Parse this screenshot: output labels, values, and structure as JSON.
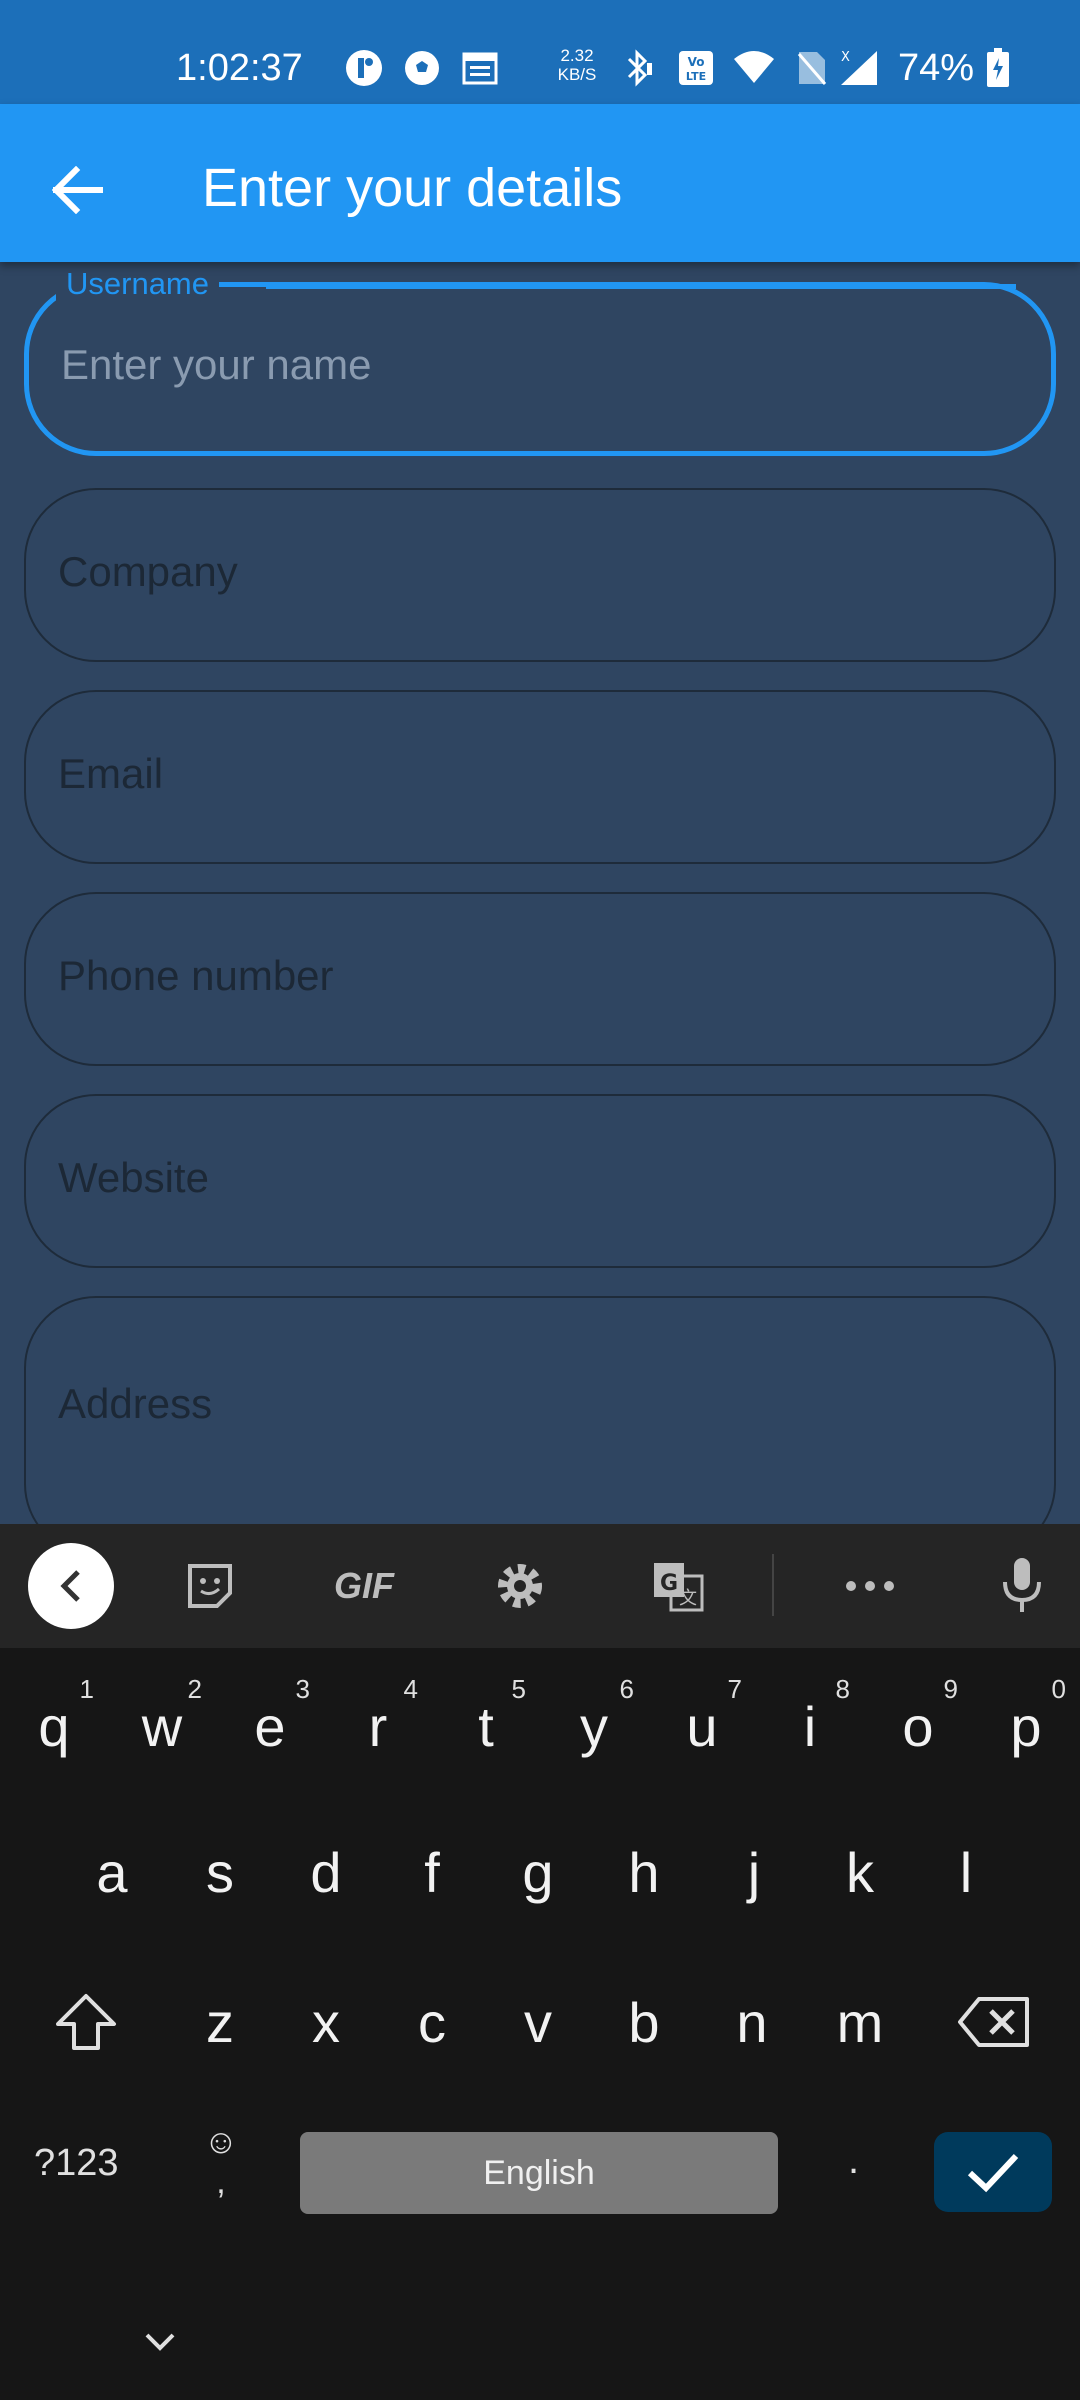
{
  "status_bar": {
    "time": "1:02:37",
    "net_speed_value": "2.32",
    "net_speed_unit": "KB/S",
    "battery": "74%",
    "icons": [
      "notification-icon",
      "soccer-ball-icon",
      "calendar-icon",
      "bluetooth-icon",
      "volte-icon",
      "wifi-icon",
      "no-sim-icon",
      "signal-icon",
      "battery-charging-icon"
    ]
  },
  "app_bar": {
    "title": "Enter your details",
    "back_icon": "arrow-back-icon"
  },
  "form": {
    "fields": [
      {
        "label": "Username",
        "placeholder": "Enter your name",
        "focused": true
      },
      {
        "placeholder": "Company"
      },
      {
        "placeholder": "Email"
      },
      {
        "placeholder": "Phone number"
      },
      {
        "placeholder": "Website"
      },
      {
        "placeholder": "Address"
      }
    ]
  },
  "keyboard": {
    "toolbar": [
      "collapse-icon",
      "sticker-icon",
      "GIF",
      "settings-icon",
      "translate-icon",
      "more-icon",
      "microphone-icon"
    ],
    "gif_label": "GIF",
    "row1": [
      {
        "key": "q",
        "hint": "1"
      },
      {
        "key": "w",
        "hint": "2"
      },
      {
        "key": "e",
        "hint": "3"
      },
      {
        "key": "r",
        "hint": "4"
      },
      {
        "key": "t",
        "hint": "5"
      },
      {
        "key": "y",
        "hint": "6"
      },
      {
        "key": "u",
        "hint": "7"
      },
      {
        "key": "i",
        "hint": "8"
      },
      {
        "key": "o",
        "hint": "9"
      },
      {
        "key": "p",
        "hint": "0"
      }
    ],
    "row2": [
      "a",
      "s",
      "d",
      "f",
      "g",
      "h",
      "j",
      "k",
      "l"
    ],
    "row3": [
      "z",
      "x",
      "c",
      "v",
      "b",
      "n",
      "m"
    ],
    "symbols_label": "?123",
    "comma_label": ",",
    "emoji_glyph": "☺",
    "space_label": "English",
    "period_label": ".",
    "accent": "#2196f3",
    "enter_color": "#003a5c"
  }
}
